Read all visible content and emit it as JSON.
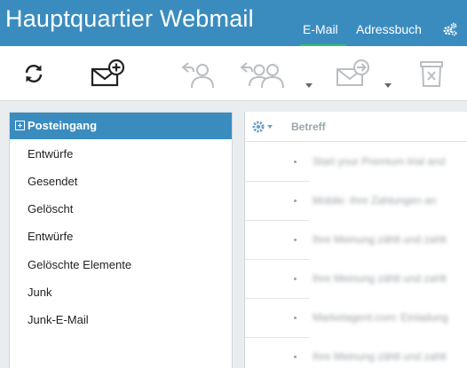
{
  "header": {
    "title": "Hauptquartier Webmail",
    "nav": [
      {
        "label": "E-Mail",
        "active": true
      },
      {
        "label": "Adressbuch",
        "active": false
      }
    ],
    "settings_icon": "gears-icon",
    "brand_color": "#3a8cbf",
    "active_underline_color": "#2fc16a"
  },
  "toolbar": {
    "buttons": [
      {
        "name": "refresh",
        "icon": "refresh-icon",
        "enabled": true
      },
      {
        "name": "compose",
        "icon": "compose-mail-icon",
        "enabled": true
      },
      {
        "name": "reply",
        "icon": "reply-icon",
        "enabled": false
      },
      {
        "name": "reply-all",
        "icon": "reply-all-icon",
        "enabled": false
      },
      {
        "name": "forward",
        "icon": "forward-mail-icon",
        "enabled": false
      },
      {
        "name": "delete",
        "icon": "delete-icon",
        "enabled": false
      }
    ]
  },
  "folders": {
    "selected": "Posteingang",
    "items": [
      "Entwürfe",
      "Gesendet",
      "Gelöscht",
      "Entwürfe",
      "Gelöschte Elemente",
      "Junk",
      "Junk-E-Mail"
    ]
  },
  "messages": {
    "column_subject": "Betreff",
    "rows": [
      "Start your Premium trial and",
      "Mobile: Ihre Zahlungen an",
      "Ihre Meinung zählt und zahlt",
      "Ihre Meinung zählt und zahlt",
      "Marketagent.com: Einladung",
      "Ihre Meinung zählt und zahlt"
    ]
  }
}
